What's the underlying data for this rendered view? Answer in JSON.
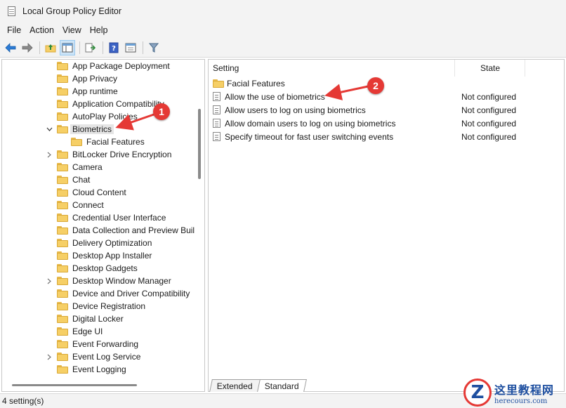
{
  "window": {
    "title": "Local Group Policy Editor"
  },
  "menu": [
    "File",
    "Action",
    "View",
    "Help"
  ],
  "toolbar_icons": [
    "back-arrow-icon",
    "forward-arrow-icon",
    "up-folder-icon",
    "show-hide-tree-icon",
    "export-list-icon",
    "help-icon",
    "properties-icon",
    "filter-icon"
  ],
  "tree": [
    {
      "label": "App Package Deployment",
      "expanded": null
    },
    {
      "label": "App Privacy",
      "expanded": null
    },
    {
      "label": "App runtime",
      "expanded": null
    },
    {
      "label": "Application Compatibility",
      "expanded": null
    },
    {
      "label": "AutoPlay Policies",
      "expanded": null
    },
    {
      "label": "Biometrics",
      "expanded": true,
      "selected": true
    },
    {
      "label": "Facial Features",
      "child": true
    },
    {
      "label": "BitLocker Drive Encryption",
      "expanded": false
    },
    {
      "label": "Camera",
      "expanded": null
    },
    {
      "label": "Chat",
      "expanded": null
    },
    {
      "label": "Cloud Content",
      "expanded": null
    },
    {
      "label": "Connect",
      "expanded": null
    },
    {
      "label": "Credential User Interface",
      "expanded": null
    },
    {
      "label": "Data Collection and Preview Buil",
      "expanded": null
    },
    {
      "label": "Delivery Optimization",
      "expanded": null
    },
    {
      "label": "Desktop App Installer",
      "expanded": null
    },
    {
      "label": "Desktop Gadgets",
      "expanded": null
    },
    {
      "label": "Desktop Window Manager",
      "expanded": false
    },
    {
      "label": "Device and Driver Compatibility",
      "expanded": null
    },
    {
      "label": "Device Registration",
      "expanded": null
    },
    {
      "label": "Digital Locker",
      "expanded": null
    },
    {
      "label": "Edge UI",
      "expanded": null
    },
    {
      "label": "Event Forwarding",
      "expanded": null
    },
    {
      "label": "Event Log Service",
      "expanded": false
    },
    {
      "label": "Event Logging",
      "expanded": null
    }
  ],
  "list": {
    "columns": {
      "setting": "Setting",
      "state": "State"
    },
    "folder_row": "Facial Features",
    "rows": [
      {
        "name": "Allow the use of biometrics",
        "state": "Not configured"
      },
      {
        "name": "Allow users to log on using biometrics",
        "state": "Not configured"
      },
      {
        "name": "Allow domain users to log on using biometrics",
        "state": "Not configured"
      },
      {
        "name": "Specify timeout for fast user switching events",
        "state": "Not configured"
      }
    ]
  },
  "tabs": [
    "Extended",
    "Standard"
  ],
  "active_tab": "Standard",
  "status": "4 setting(s)",
  "callouts": [
    "1",
    "2"
  ],
  "watermark": {
    "logo": "Z",
    "site_name": "这里教程网",
    "url": "herecours.com"
  },
  "colors": {
    "accent": "#e53935",
    "selection": "#e5e5e5",
    "folder": "#f6cf66",
    "watermark": "#1e4fa0"
  }
}
